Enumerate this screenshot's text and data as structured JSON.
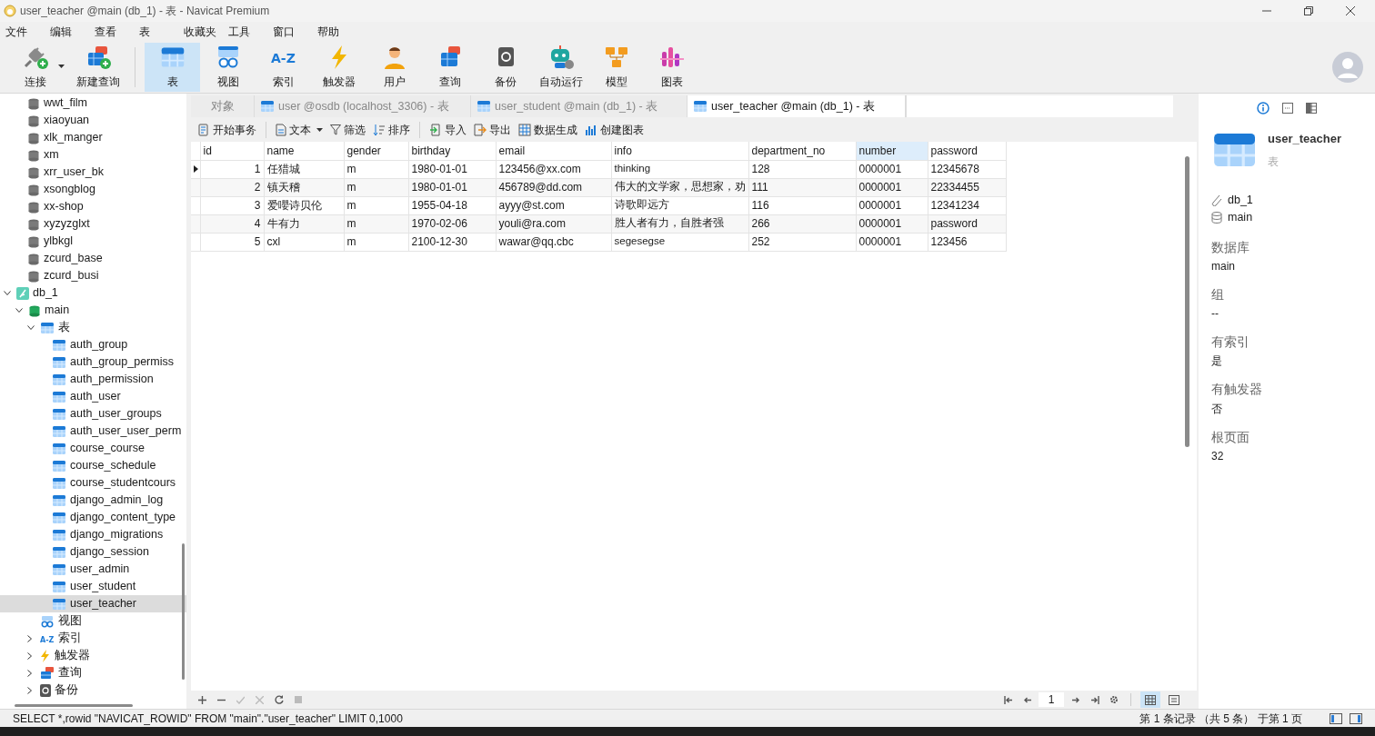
{
  "window": {
    "title": "user_teacher @main (db_1) - 表 - Navicat Premium"
  },
  "menu": [
    "文件",
    "编辑",
    "查看",
    "表",
    "收藏夹",
    "工具",
    "窗口",
    "帮助"
  ],
  "toolbar": [
    {
      "kind": "connect",
      "label": "连接",
      "selected": false,
      "dropdown": true
    },
    {
      "kind": "new-query",
      "label": "新建查询",
      "selected": false,
      "dropdown": false
    },
    {
      "kind": "table",
      "label": "表",
      "selected": true,
      "dropdown": false
    },
    {
      "kind": "view",
      "label": "视图",
      "selected": false,
      "dropdown": false
    },
    {
      "kind": "index",
      "label": "索引",
      "icon_text": "A-Z",
      "selected": false,
      "dropdown": false
    },
    {
      "kind": "trigger",
      "label": "触发器",
      "selected": false,
      "dropdown": false
    },
    {
      "kind": "user",
      "label": "用户",
      "selected": false,
      "dropdown": false
    },
    {
      "kind": "query",
      "label": "查询",
      "selected": false,
      "dropdown": false
    },
    {
      "kind": "backup",
      "label": "备份",
      "selected": false,
      "dropdown": false
    },
    {
      "kind": "automation",
      "label": "自动运行",
      "selected": false,
      "dropdown": false
    },
    {
      "kind": "model",
      "label": "模型",
      "selected": false,
      "dropdown": false
    },
    {
      "kind": "chart",
      "label": "图表",
      "selected": false,
      "dropdown": false
    }
  ],
  "sidebar": {
    "tree": [
      {
        "kind": "database",
        "label": "wwt_film",
        "selected": false
      },
      {
        "kind": "database",
        "label": "xiaoyuan",
        "selected": false
      },
      {
        "kind": "database",
        "label": "xlk_manger",
        "selected": false
      },
      {
        "kind": "database",
        "label": "xm",
        "selected": false
      },
      {
        "kind": "database",
        "label": "xrr_user_bk",
        "selected": false
      },
      {
        "kind": "database",
        "label": "xsongblog",
        "selected": false
      },
      {
        "kind": "database",
        "label": "xx-shop",
        "selected": false
      },
      {
        "kind": "database",
        "label": "xyzyzglxt",
        "selected": false
      },
      {
        "kind": "database",
        "label": "ylbkgl",
        "selected": false
      },
      {
        "kind": "database",
        "label": "zcurd_base",
        "selected": false
      },
      {
        "kind": "database",
        "label": "zcurd_busi",
        "selected": false
      },
      {
        "kind": "connection",
        "label": "db_1",
        "selected": false,
        "expanded": true,
        "children": [
          {
            "kind": "schema",
            "label": "main",
            "selected": false,
            "expanded": true,
            "children": [
              {
                "kind": "table",
                "label": "表",
                "selected": false,
                "expanded": true,
                "children": [
                  {
                    "kind": "table",
                    "label": "auth_group",
                    "selected": false
                  },
                  {
                    "kind": "table",
                    "label": "auth_group_permiss",
                    "selected": false
                  },
                  {
                    "kind": "table",
                    "label": "auth_permission",
                    "selected": false
                  },
                  {
                    "kind": "table",
                    "label": "auth_user",
                    "selected": false
                  },
                  {
                    "kind": "table",
                    "label": "auth_user_groups",
                    "selected": false
                  },
                  {
                    "kind": "table",
                    "label": "auth_user_user_perm",
                    "selected": false
                  },
                  {
                    "kind": "table",
                    "label": "course_course",
                    "selected": false
                  },
                  {
                    "kind": "table",
                    "label": "course_schedule",
                    "selected": false
                  },
                  {
                    "kind": "table",
                    "label": "course_studentcours",
                    "selected": false
                  },
                  {
                    "kind": "table",
                    "label": "django_admin_log",
                    "selected": false
                  },
                  {
                    "kind": "table",
                    "label": "django_content_type",
                    "selected": false
                  },
                  {
                    "kind": "table",
                    "label": "django_migrations",
                    "selected": false
                  },
                  {
                    "kind": "table",
                    "label": "django_session",
                    "selected": false
                  },
                  {
                    "kind": "table",
                    "label": "user_admin",
                    "selected": false
                  },
                  {
                    "kind": "table",
                    "label": "user_student",
                    "selected": false
                  },
                  {
                    "kind": "table",
                    "label": "user_teacher",
                    "selected": true
                  }
                ]
              },
              {
                "kind": "view",
                "label": "视图",
                "selected": false
              },
              {
                "kind": "index",
                "label": "索引",
                "icon_text": "A-Z",
                "selected": false,
                "expanded": false
              },
              {
                "kind": "trigger",
                "label": "触发器",
                "selected": false,
                "expanded": false
              },
              {
                "kind": "query",
                "label": "查询",
                "selected": false,
                "expanded": false
              },
              {
                "kind": "backup",
                "label": "备份",
                "selected": false,
                "expanded": false
              }
            ]
          }
        ]
      }
    ]
  },
  "tabs": [
    {
      "kind": "objects",
      "label": "对象",
      "selected": false
    },
    {
      "kind": "table",
      "label": "user @osdb (localhost_3306) - 表",
      "selected": false
    },
    {
      "kind": "table",
      "label": "user_student @main (db_1) - 表",
      "selected": false
    },
    {
      "kind": "table",
      "label": "user_teacher @main (db_1) - 表",
      "selected": true
    }
  ],
  "grid_toolbar": [
    {
      "kind": "transaction",
      "label": "开始事务",
      "dropdown": false
    },
    {
      "kind": "text",
      "label": "文本",
      "dropdown": true
    },
    {
      "kind": "filter",
      "label": "筛选",
      "dropdown": false
    },
    {
      "kind": "sort",
      "label": "排序",
      "dropdown": false
    },
    {
      "kind": "import",
      "label": "导入",
      "dropdown": false
    },
    {
      "kind": "export",
      "label": "导出",
      "dropdown": false
    },
    {
      "kind": "generate",
      "label": "数据生成",
      "dropdown": false
    },
    {
      "kind": "chart",
      "label": "创建图表",
      "dropdown": false
    }
  ],
  "table": {
    "columns": [
      {
        "label": "id",
        "selected": false
      },
      {
        "label": "name",
        "selected": false
      },
      {
        "label": "gender",
        "selected": false
      },
      {
        "label": "birthday",
        "selected": false
      },
      {
        "label": "email",
        "selected": false
      },
      {
        "label": "info",
        "selected": false
      },
      {
        "label": "department_no",
        "selected": false
      },
      {
        "label": "number",
        "selected": true
      },
      {
        "label": "password",
        "selected": false
      }
    ],
    "rows": [
      {
        "current": true,
        "cells": [
          "1",
          "任猎城",
          "m",
          "1980-01-01",
          "123456@xx.com",
          "thinking",
          "128",
          "0000001",
          "12345678"
        ]
      },
      {
        "current": false,
        "cells": [
          "2",
          "镇天稽",
          "m",
          "1980-01-01",
          "456789@dd.com",
          "伟大的文学家，思想家，劝",
          "111",
          "0000001",
          "22334455"
        ]
      },
      {
        "current": false,
        "cells": [
          "3",
          "爱嚶诗贝伦",
          "m",
          "1955-04-18",
          "ayyy@st.com",
          "诗歌即远方",
          "116",
          "0000001",
          "12341234"
        ]
      },
      {
        "current": false,
        "cells": [
          "4",
          "牛有力",
          "m",
          "1970-02-06",
          "youli@ra.com",
          "胜人者有力，自胜者强",
          "266",
          "0000001",
          "password"
        ]
      },
      {
        "current": false,
        "cells": [
          "5",
          "cxl",
          "m",
          "2100-12-30",
          "wawar@qq.cbc",
          "segesegse",
          "252",
          "0000001",
          "123456"
        ]
      }
    ]
  },
  "pager": {
    "page": "1",
    "grid_view_selected": true
  },
  "status_bar": {
    "sql": "SELECT *,rowid \"NAVICAT_ROWID\" FROM \"main\".\"user_teacher\" LIMIT 0,1000",
    "record": "第 1 条记录 （共 5 条） 于第 1 页"
  },
  "info_panel": {
    "name": "user_teacher",
    "type": "表",
    "connection": "db_1",
    "schema": "main",
    "properties": [
      {
        "label": "数据库",
        "value": "main"
      },
      {
        "label": "组",
        "value": "--"
      },
      {
        "label": "有索引",
        "value": "是"
      },
      {
        "label": "有触发器",
        "value": "否"
      },
      {
        "label": "根页面",
        "value": "32"
      }
    ]
  }
}
